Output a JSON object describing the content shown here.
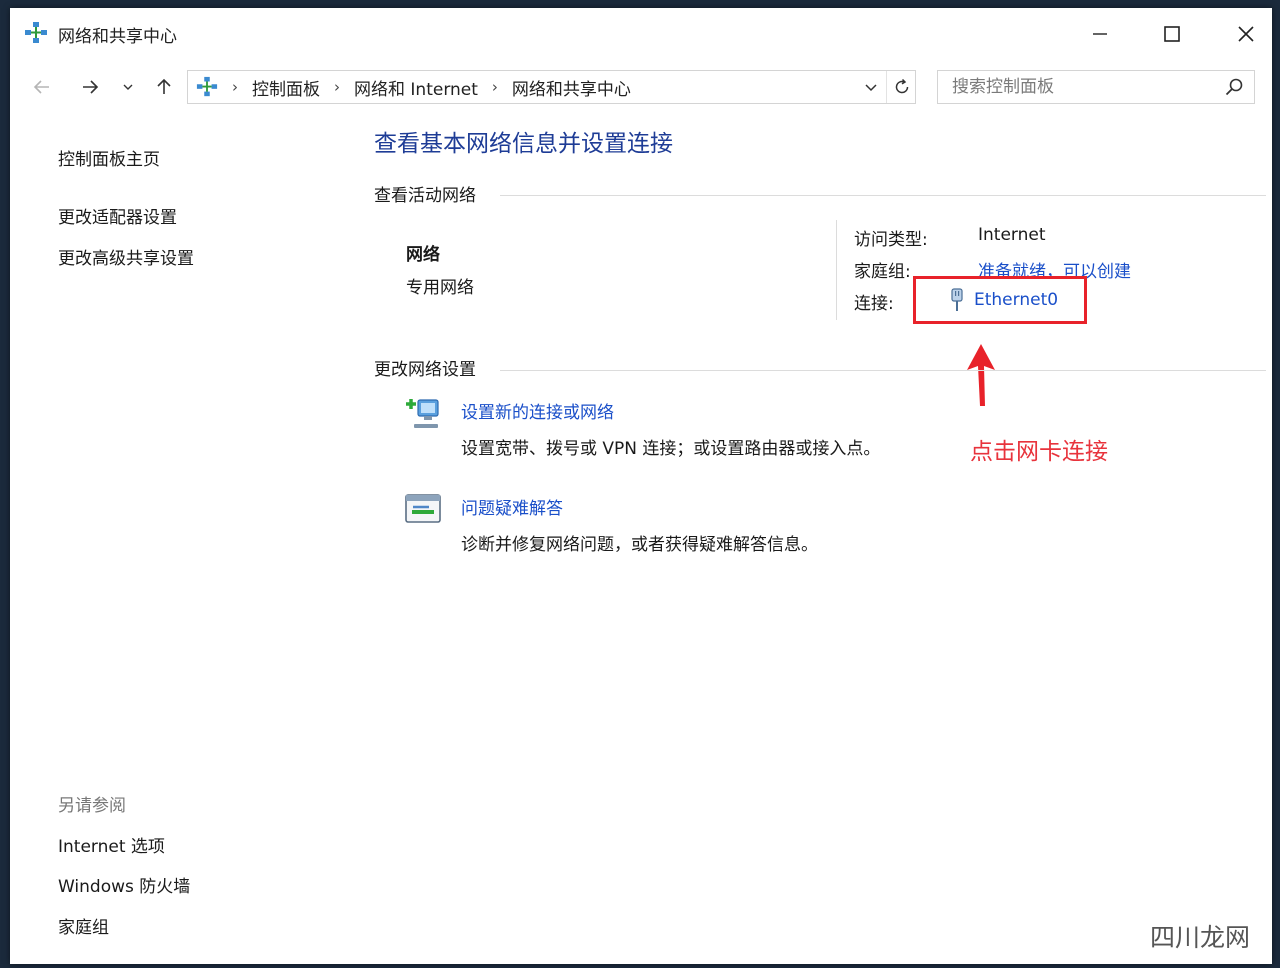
{
  "window": {
    "title": "网络和共享中心"
  },
  "address_bar": {
    "crumbs": [
      "控制面板",
      "网络和 Internet",
      "网络和共享中心"
    ],
    "separator": "›"
  },
  "search": {
    "placeholder": "搜索控制面板"
  },
  "sidebar": {
    "items": [
      {
        "label": "控制面板主页"
      },
      {
        "label": "更改适配器设置"
      },
      {
        "label": "更改高级共享设置"
      }
    ],
    "see_also_title": "另请参阅",
    "see_also": [
      {
        "label": "Internet 选项"
      },
      {
        "label": "Windows 防火墙"
      },
      {
        "label": "家庭组"
      }
    ]
  },
  "main": {
    "title": "查看基本网络信息并设置连接",
    "active_networks_header": "查看活动网络",
    "network": {
      "name": "网络",
      "type": "专用网络",
      "access_type_label": "访问类型:",
      "access_type_value": "Internet",
      "homegroup_label": "家庭组:",
      "homegroup_value": "准备就绪，可以创建",
      "connection_label": "连接:",
      "connection_value": "Ethernet0"
    },
    "change_settings_header": "更改网络设置",
    "tasks": [
      {
        "title": "设置新的连接或网络",
        "desc": "设置宽带、拨号或 VPN 连接；或设置路由器或接入点。"
      },
      {
        "title": "问题疑难解答",
        "desc": "诊断并修复网络问题，或者获得疑难解答信息。"
      }
    ]
  },
  "annotation": {
    "text": "点击网卡连接",
    "color": "#e8333c"
  },
  "watermark": {
    "text": "四川龙网"
  },
  "colors": {
    "link": "#1a4fc9",
    "title": "#1e3c96",
    "highlight": "#e8222a"
  }
}
